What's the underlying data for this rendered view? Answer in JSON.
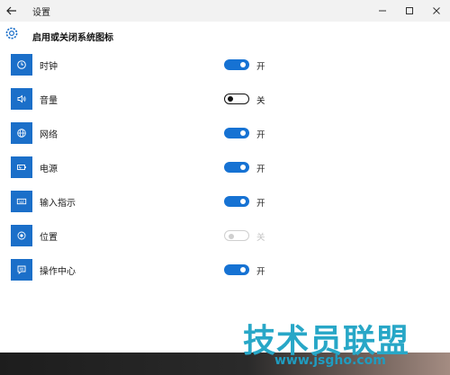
{
  "window": {
    "title": "设置"
  },
  "header": {
    "title": "启用或关闭系统图标"
  },
  "items": [
    {
      "label": "时钟",
      "icon": "clock-icon",
      "state": "on",
      "state_label": "开"
    },
    {
      "label": "音量",
      "icon": "volume-icon",
      "state": "off",
      "state_label": "关"
    },
    {
      "label": "网络",
      "icon": "globe-icon",
      "state": "on",
      "state_label": "开"
    },
    {
      "label": "电源",
      "icon": "battery-icon",
      "state": "on",
      "state_label": "开"
    },
    {
      "label": "输入指示",
      "icon": "keyboard-icon",
      "state": "on",
      "state_label": "开"
    },
    {
      "label": "位置",
      "icon": "location-icon",
      "state": "disabled",
      "state_label": "关"
    },
    {
      "label": "操作中心",
      "icon": "action-center-icon",
      "state": "on",
      "state_label": "开"
    }
  ],
  "watermark": {
    "brand": "技术员联盟",
    "url": "www.jsgho.com"
  },
  "colors": {
    "accent": "#1672d3",
    "tile": "#1b6fc9",
    "titlebar": "#f2f2f2",
    "watermark": "#28a7c7"
  }
}
